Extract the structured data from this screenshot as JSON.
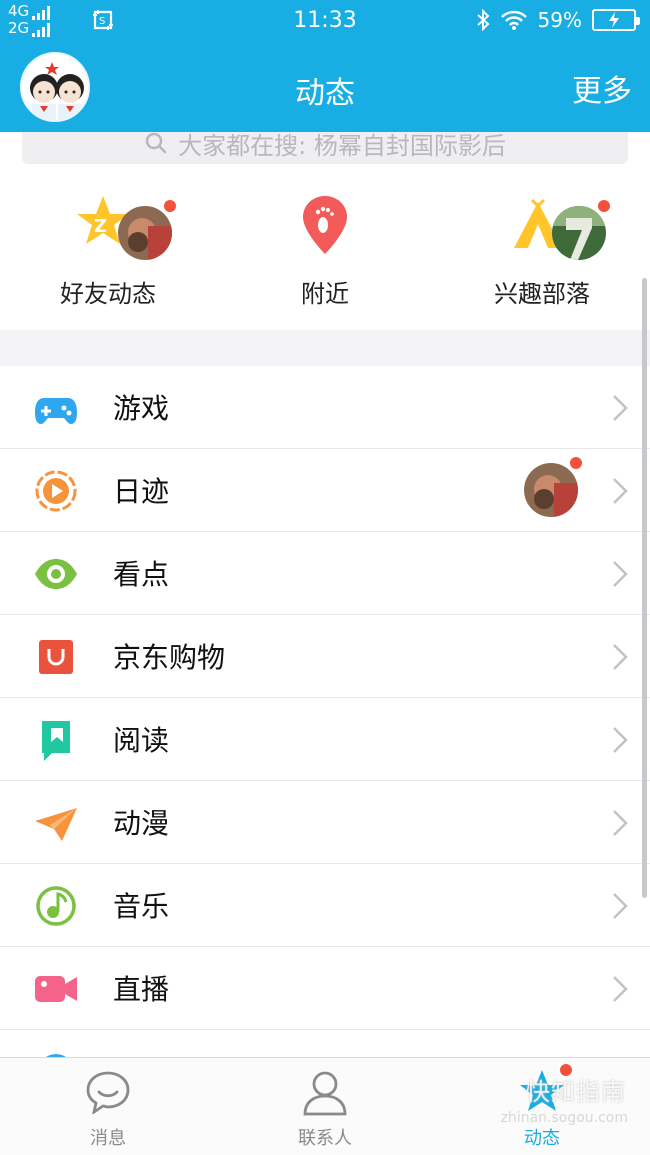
{
  "status": {
    "net1": "4G",
    "net2": "2G",
    "time": "11:33",
    "battery": "59%"
  },
  "header": {
    "title": "动态",
    "more": "更多"
  },
  "search": {
    "placeholder": "大家都在搜: 杨幂自封国际影后"
  },
  "quick": [
    {
      "label": "好友动态",
      "icon": "star-z-icon"
    },
    {
      "label": "附近",
      "icon": "location-pin-icon"
    },
    {
      "label": "兴趣部落",
      "icon": "tent-icon"
    }
  ],
  "items": [
    {
      "label": "游戏",
      "icon": "gamepad-icon",
      "color": "#2ea7ee"
    },
    {
      "label": "日迹",
      "icon": "play-ring-icon",
      "color": "#f7943b"
    },
    {
      "label": "看点",
      "icon": "eye-icon",
      "color": "#7ac142"
    },
    {
      "label": "京东购物",
      "icon": "shopping-bag-icon",
      "color": "#e9533d"
    },
    {
      "label": "阅读",
      "icon": "book-icon",
      "color": "#1fc8a0"
    },
    {
      "label": "动漫",
      "icon": "paper-plane-icon",
      "color": "#f7943b"
    },
    {
      "label": "音乐",
      "icon": "music-note-icon",
      "color": "#7ac142"
    },
    {
      "label": "直播",
      "icon": "video-camera-icon",
      "color": "#f4648a"
    }
  ],
  "nav": {
    "messages": "消息",
    "contacts": "联系人",
    "feeds": "动态"
  },
  "watermark": {
    "text": "快知指南",
    "sub": "zhinan.sogou.com"
  },
  "colors": {
    "brand": "#18aee4",
    "badge": "#f2513c"
  }
}
